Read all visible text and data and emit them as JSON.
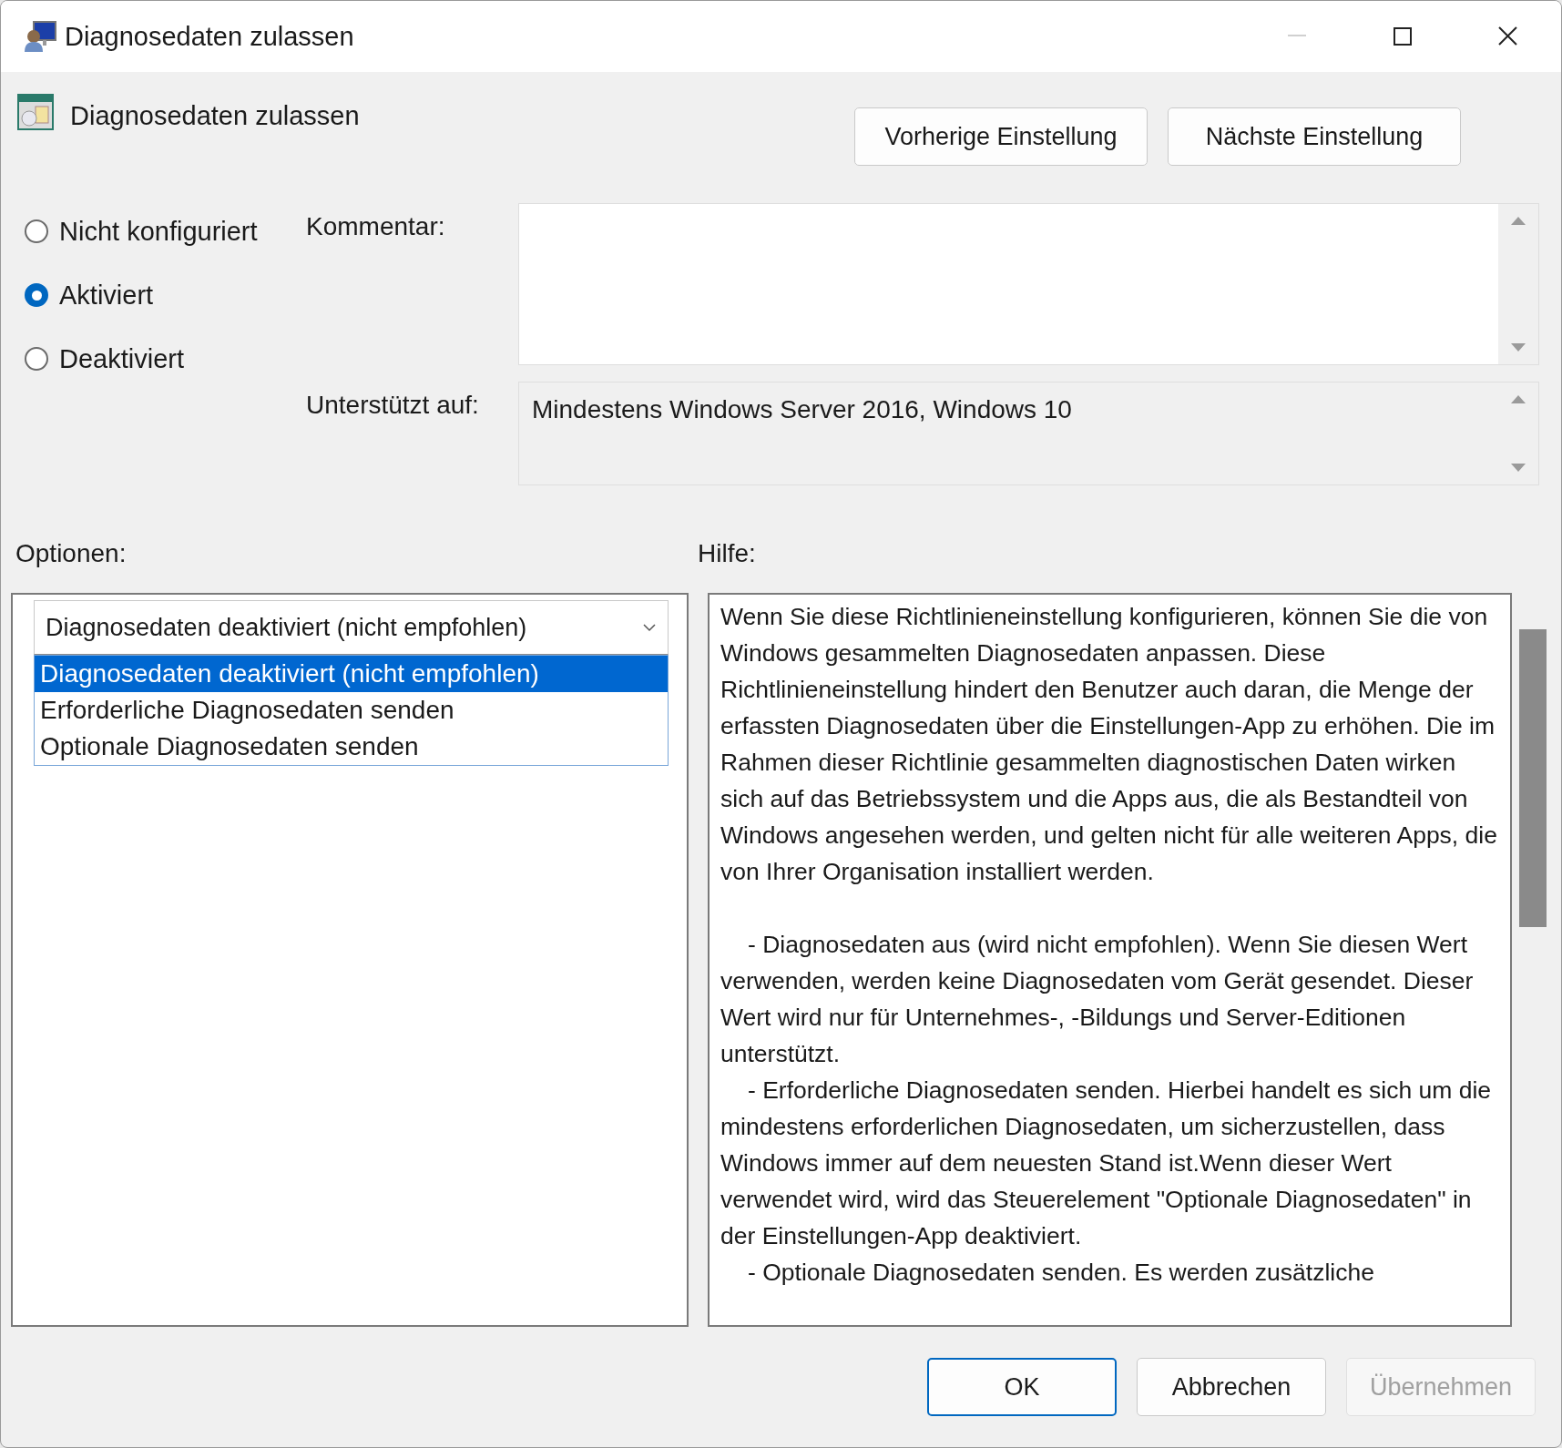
{
  "window": {
    "title": "Diagnosedaten zulassen"
  },
  "header": {
    "title": "Diagnosedaten zulassen"
  },
  "nav_buttons": [
    {
      "label": "Vorherige Einstellung"
    },
    {
      "label": "Nächste Einstellung"
    }
  ],
  "state_options": [
    {
      "label": "Nicht konfiguriert",
      "selected": false
    },
    {
      "label": "Aktiviert",
      "selected": true
    },
    {
      "label": "Deaktiviert",
      "selected": false
    }
  ],
  "comment": {
    "label": "Kommentar:"
  },
  "supported": {
    "label": "Unterstützt auf:",
    "value": "Mindestens Windows Server 2016, Windows 10"
  },
  "options": {
    "label": "Optionen:",
    "dropdown": {
      "value": "Diagnosedaten deaktiviert (nicht empfohlen)",
      "expanded": true,
      "items": [
        {
          "label": "Diagnosedaten deaktiviert (nicht empfohlen)",
          "selected": true
        },
        {
          "label": "Erforderliche Diagnosedaten senden",
          "selected": false
        },
        {
          "label": "Optionale Diagnosedaten senden",
          "selected": false
        }
      ]
    }
  },
  "help": {
    "label": "Hilfe:",
    "paragraphs": [
      {
        "kind": "intro",
        "text": "Wenn Sie diese Richtlinieneinstellung konfigurieren, können Sie die von Windows gesammelten Diagnosedaten anpassen. Diese Richtlinieneinstellung hindert den Benutzer auch daran, die Menge der erfassten Diagnosedaten über die Einstellungen-App zu erhöhen. Die im Rahmen dieser Richtlinie gesammelten diagnostischen Daten wirken sich auf das Betriebssystem und die Apps aus, die als Bestandteil von Windows angesehen werden, und gelten nicht für alle weiteren Apps, die von Ihrer Organisation installiert werden."
      },
      {
        "kind": "bullet",
        "text": "- Diagnosedaten aus (wird nicht empfohlen). Wenn Sie diesen Wert verwenden, werden keine Diagnosedaten vom Gerät gesendet. Dieser Wert wird nur für Unternehmes-, -Bildungs und Server-Editionen unterstützt."
      },
      {
        "kind": "bullet",
        "text": "- Erforderliche Diagnosedaten senden. Hierbei handelt es sich um die mindestens erforderlichen Diagnosedaten, um sicherzustellen, dass Windows immer auf dem neuesten Stand ist.Wenn dieser Wert verwendet wird, wird das Steuerelement \"Optionale Diagnosedaten\" in der Einstellungen-App deaktiviert."
      },
      {
        "kind": "bullet",
        "text": "- Optionale Diagnosedaten senden. Es werden zusätzliche"
      }
    ]
  },
  "footer_buttons": [
    {
      "label": "OK",
      "kind": "default",
      "disabled": false
    },
    {
      "label": "Abbrechen",
      "kind": "normal",
      "disabled": false
    },
    {
      "label": "Übernehmen",
      "kind": "normal",
      "disabled": true
    }
  ]
}
